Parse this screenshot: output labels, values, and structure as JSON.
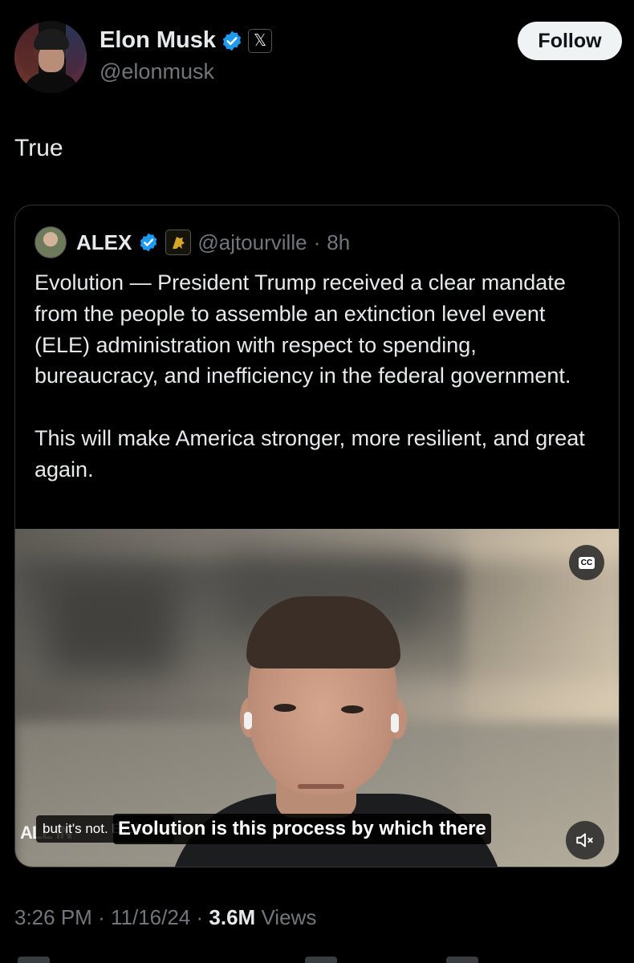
{
  "author": {
    "display_name": "Elon Musk",
    "handle": "@elonmusk",
    "verified_icon": "verified-badge-icon",
    "affiliation_icon": "x-logo-icon"
  },
  "follow_button": {
    "label": "Follow"
  },
  "tweet": {
    "text": "True"
  },
  "quote": {
    "display_name": "ALEX",
    "handle": "@ajtourville",
    "separator": "·",
    "time": "8h",
    "paragraph_1": "Evolution — President Trump received a clear mandate from the people to assemble an extinction level event (ELE) administration with respect to spending, bureaucracy, and inefficiency in the federal government.",
    "paragraph_2": "This will make America stronger, more resilient, and great again."
  },
  "video": {
    "cc_label": "CC",
    "caption_small": "but it's not. Evolution",
    "caption_main": "Evolution is this process by which there",
    "watermark": "ALL IN",
    "mute_icon": "speaker-muted-icon"
  },
  "footer": {
    "time": "3:26 PM",
    "date": "11/16/24",
    "views_count": "3.6M",
    "views_label": "Views",
    "sep": "·"
  },
  "colors": {
    "background": "#000000",
    "text": "#e7e9ea",
    "secondary": "#71767b",
    "verified_blue": "#1d9bf0",
    "border": "#2f3336"
  }
}
